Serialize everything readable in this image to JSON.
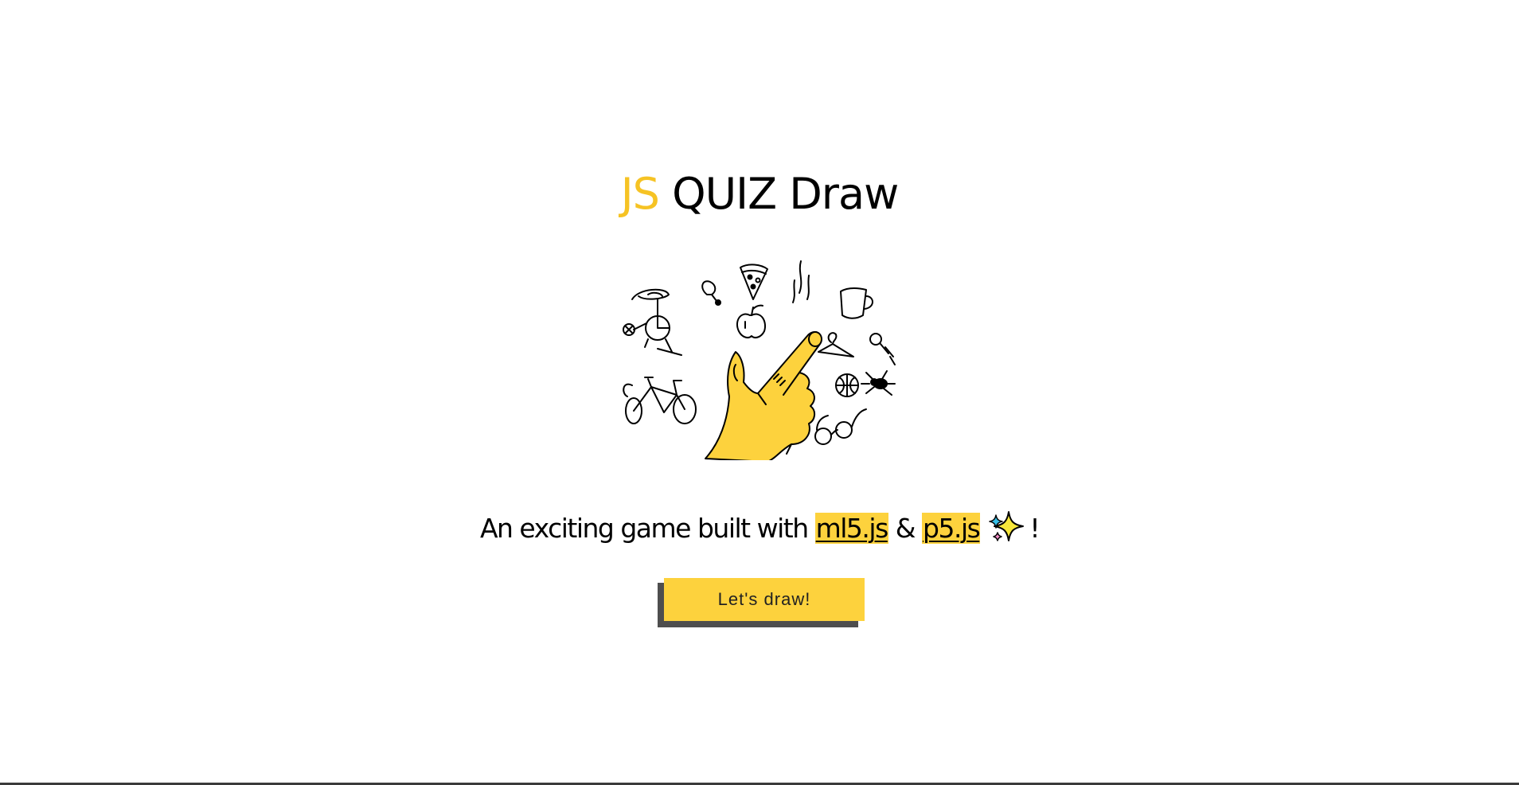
{
  "title": {
    "accent": "JS",
    "rest": "QUIZ Draw"
  },
  "hero": {
    "icon": "hand-drawing-doodles-illustration"
  },
  "tagline": {
    "prefix": "An exciting game built with",
    "link1": "ml5.js",
    "amp": "&",
    "link2": "p5.js",
    "sparkle_icon": "sparkles-icon",
    "suffix": "!"
  },
  "cta": {
    "label": "Let's draw!"
  },
  "colors": {
    "accent": "#f6c324",
    "highlight": "#fdd23d",
    "button_shadow": "#4e4e4e"
  }
}
